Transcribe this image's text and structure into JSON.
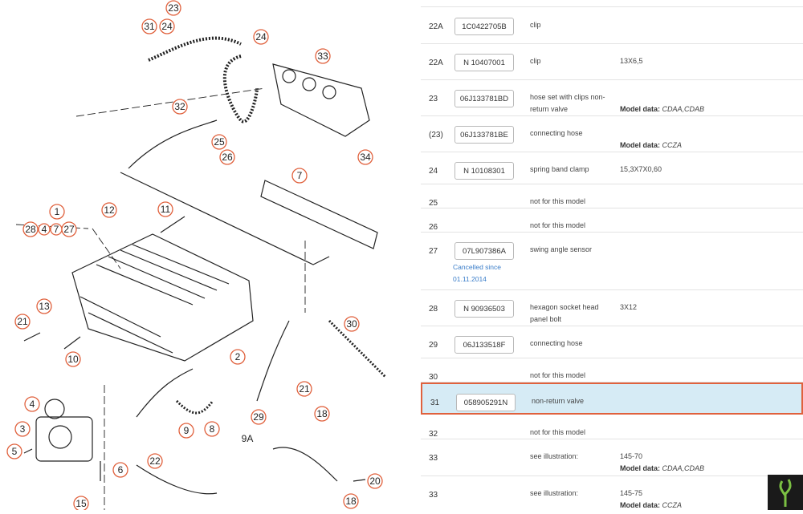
{
  "diagram_callouts": [
    "23",
    "31",
    "24",
    "24",
    "33",
    "32",
    "25",
    "26",
    "34",
    "7",
    "1",
    "28",
    "4",
    "7",
    "27",
    "12",
    "11",
    "13",
    "21",
    "10",
    "2",
    "30",
    "4",
    "21",
    "18",
    "3",
    "9",
    "8",
    "9A",
    "29",
    "5",
    "6",
    "22",
    "20",
    "15",
    "18"
  ],
  "parts": [
    {
      "pos": "22A",
      "part_no": "1C0422705B",
      "desc": "clip",
      "remark": "",
      "model": "",
      "cancel": ""
    },
    {
      "pos": "22A",
      "part_no": "N 10407001",
      "desc": "clip",
      "remark": "13X6,5",
      "model": "",
      "cancel": ""
    },
    {
      "pos": "23",
      "part_no": "06J133781BD",
      "desc": "hose set with clips non-return valve",
      "remark": "",
      "model": "CDAA,CDAB",
      "cancel": ""
    },
    {
      "pos": "(23)",
      "part_no": "06J133781BE",
      "desc": "connecting hose",
      "remark": "",
      "model": "CCZA",
      "cancel": ""
    },
    {
      "pos": "24",
      "part_no": "N 10108301",
      "desc": "spring band clamp",
      "remark": "15,3X7X0,60",
      "model": "",
      "cancel": ""
    },
    {
      "pos": "25",
      "part_no": "",
      "desc": "not for this model",
      "remark": "",
      "model": "",
      "cancel": ""
    },
    {
      "pos": "26",
      "part_no": "",
      "desc": "not for this model",
      "remark": "",
      "model": "",
      "cancel": ""
    },
    {
      "pos": "27",
      "part_no": "07L907386A",
      "desc": "swing angle sensor",
      "remark": "",
      "model": "",
      "cancel": "Cancelled since 01.11.2014"
    },
    {
      "pos": "28",
      "part_no": "N 90936503",
      "desc": "hexagon socket head panel bolt",
      "remark": "3X12",
      "model": "",
      "cancel": ""
    },
    {
      "pos": "29",
      "part_no": "06J133518F",
      "desc": "connecting hose",
      "remark": "",
      "model": "",
      "cancel": ""
    },
    {
      "pos": "30",
      "part_no": "",
      "desc": "not for this model",
      "remark": "",
      "model": "",
      "cancel": ""
    },
    {
      "pos": "31",
      "part_no": "058905291N",
      "desc": "non-return valve",
      "remark": "",
      "model": "",
      "cancel": ""
    },
    {
      "pos": "32",
      "part_no": "",
      "desc": "not for this model",
      "remark": "",
      "model": "",
      "cancel": ""
    },
    {
      "pos": "33",
      "part_no": "",
      "desc": "see illustration:",
      "remark": "145-70",
      "model": "CDAA,CDAB",
      "cancel": ""
    },
    {
      "pos": "33",
      "part_no": "",
      "desc": "see illustration:",
      "remark": "145-75",
      "model": "CCZA",
      "cancel": ""
    }
  ],
  "model_label": "Model data:",
  "selected_row": 11
}
